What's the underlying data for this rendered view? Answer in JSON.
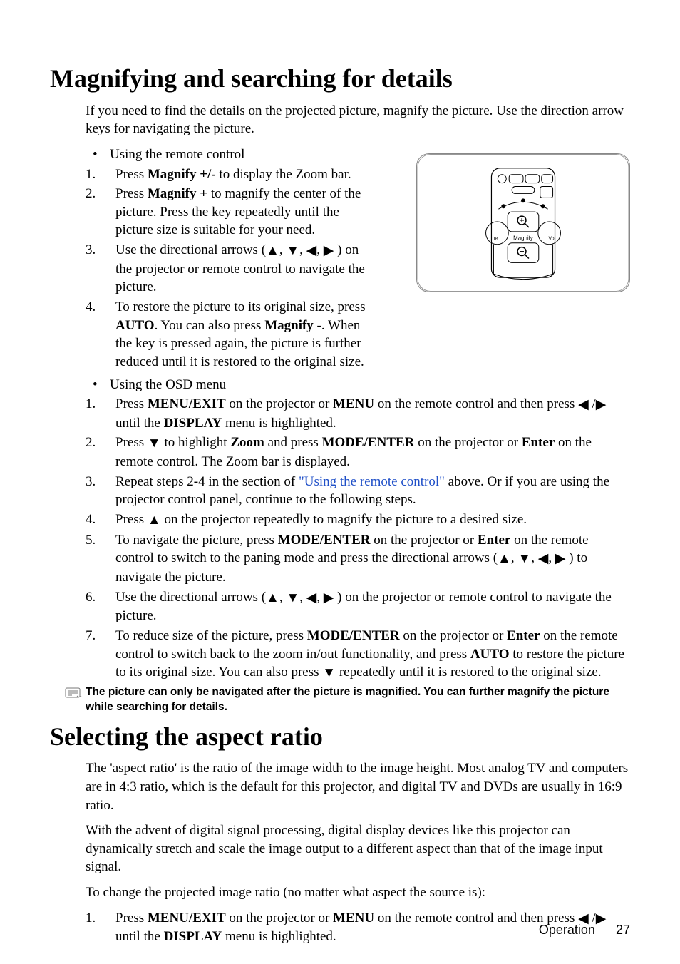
{
  "h1_magnify": "Magnifying and searching for details",
  "mag_intro": "If you need to find the details on the projected picture, magnify the picture. Use the direction arrow keys for navigating the picture.",
  "mag_section_remote": "Using the remote control",
  "mag_r1_a": "Press ",
  "mag_r1_b": "Magnify +/-",
  "mag_r1_c": " to display the Zoom bar.",
  "mag_r2_a": "Press ",
  "mag_r2_b": "Magnify +",
  "mag_r2_c": " to magnify the center of the picture. Press the key repeatedly until the picture size is suitable for your need.",
  "mag_r3_a": "Use the directional arrows (",
  "mag_r3_b": ") on the projector or remote control to navigate the picture.",
  "mag_r4_a": "To restore the picture to its original size, press ",
  "mag_r4_b": "AUTO",
  "mag_r4_c": ". You can also press ",
  "mag_r4_d": "Magnify -",
  "mag_r4_e": ". When the key is pressed again, the picture is further reduced until it is restored to the original size.",
  "mag_section_osd": "Using the OSD menu",
  "mag_o1_a": "Press ",
  "mag_o1_b": "MENU/EXIT",
  "mag_o1_c": " on the projector or ",
  "mag_o1_d": "MENU",
  "mag_o1_e": " on the remote control and then press ",
  "mag_o1_f": " until the ",
  "mag_o1_g": "DISPLAY",
  "mag_o1_h": " menu is highlighted.",
  "mag_o2_a": "Press ",
  "mag_o2_b": " to highlight ",
  "mag_o2_c": "Zoom",
  "mag_o2_d": " and press ",
  "mag_o2_e": "MODE/ENTER",
  "mag_o2_f": " on the projector or ",
  "mag_o2_g": "Enter",
  "mag_o2_h": " on the remote control. The Zoom bar is displayed.",
  "mag_o3_a": "Repeat steps 2-4 in the section of ",
  "mag_o3_link": "\"Using the remote control\"",
  "mag_o3_b": " above. Or if you are using the projector control panel, continue to the following steps.",
  "mag_o4_a": "Press ",
  "mag_o4_b": " on the projector repeatedly to magnify the picture to a desired size.",
  "mag_o5_a": "To navigate the picture, press ",
  "mag_o5_b": "MODE/ENTER",
  "mag_o5_c": " on the projector or ",
  "mag_o5_d": "Enter",
  "mag_o5_e": " on the remote control to switch to the paning mode and press the directional arrows (",
  "mag_o5_f": ") to navigate the picture.",
  "mag_o6_a": "Use the directional arrows (",
  "mag_o6_b": ") on the projector or remote control to navigate the picture.",
  "mag_o7_a": "To reduce size of the picture, press ",
  "mag_o7_b": "MODE/ENTER",
  "mag_o7_c": " on the projector or ",
  "mag_o7_d": "Enter",
  "mag_o7_e": " on the remote control to switch back to the zoom in/out functionality, and press ",
  "mag_o7_f": "AUTO",
  "mag_o7_g": " to restore the picture to its original size. You can also press ",
  "mag_o7_h": " repeatedly until it is restored to the original size.",
  "note_text": "The picture can only be navigated after the picture is magnified. You can further magnify the picture while searching for details.",
  "h1_aspect": "Selecting the aspect ratio",
  "asp_intro": "The 'aspect ratio' is the ratio of the image width to the image height. Most analog TV and computers are in 4:3 ratio, which is the default for this projector, and digital TV and DVDs are usually in 16:9 ratio.",
  "asp_p2": "With the advent of digital signal processing, digital display devices like this projector can dynamically stretch and scale the image output to a different aspect than that of the image input signal.",
  "asp_p3": "To change the projected image ratio (no matter what aspect the source is):",
  "asp_1_a": "Press ",
  "asp_1_b": "MENU/EXIT",
  "asp_1_c": " on the projector or ",
  "asp_1_d": "MENU",
  "asp_1_e": " on the remote control and then press ",
  "asp_1_f": " until the ",
  "asp_1_g": "DISPLAY",
  "asp_1_h": " menu is highlighted.",
  "footer_label": "Operation",
  "footer_page": "27",
  "remote_label": "Magnify",
  "num1": "1.",
  "num2": "2.",
  "num3": "3.",
  "num4": "4.",
  "num5": "5.",
  "num6": "6.",
  "num7": "7.",
  "bullet": "•",
  "slash": "/",
  "comma": ", "
}
